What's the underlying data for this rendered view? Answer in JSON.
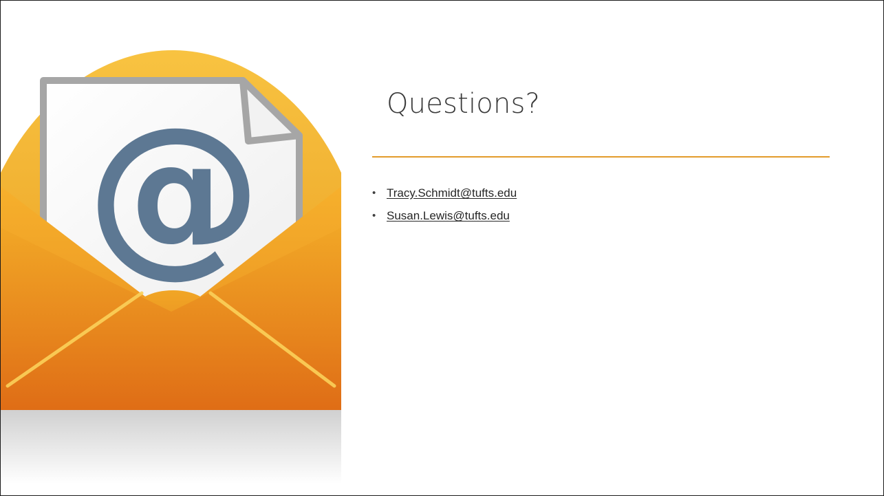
{
  "slide": {
    "title": "Questions?",
    "contacts": [
      {
        "bullet": "•",
        "email": "Tracy.Schmidt@tufts.edu"
      },
      {
        "bullet": "•",
        "email": "Susan.Lewis@tufts.edu"
      }
    ]
  },
  "illustration": {
    "icon": "envelope-at-icon",
    "glyph": "@",
    "colors": {
      "envelope_light": "#f5b82e",
      "envelope_dark": "#e16d16",
      "letter": "#ffffff",
      "letter_border": "#a6a6a6",
      "at_symbol": "#5d7893"
    }
  },
  "theme": {
    "accent": "#e39b2a",
    "title_color": "#3a3a3a",
    "text_color": "#262626"
  }
}
